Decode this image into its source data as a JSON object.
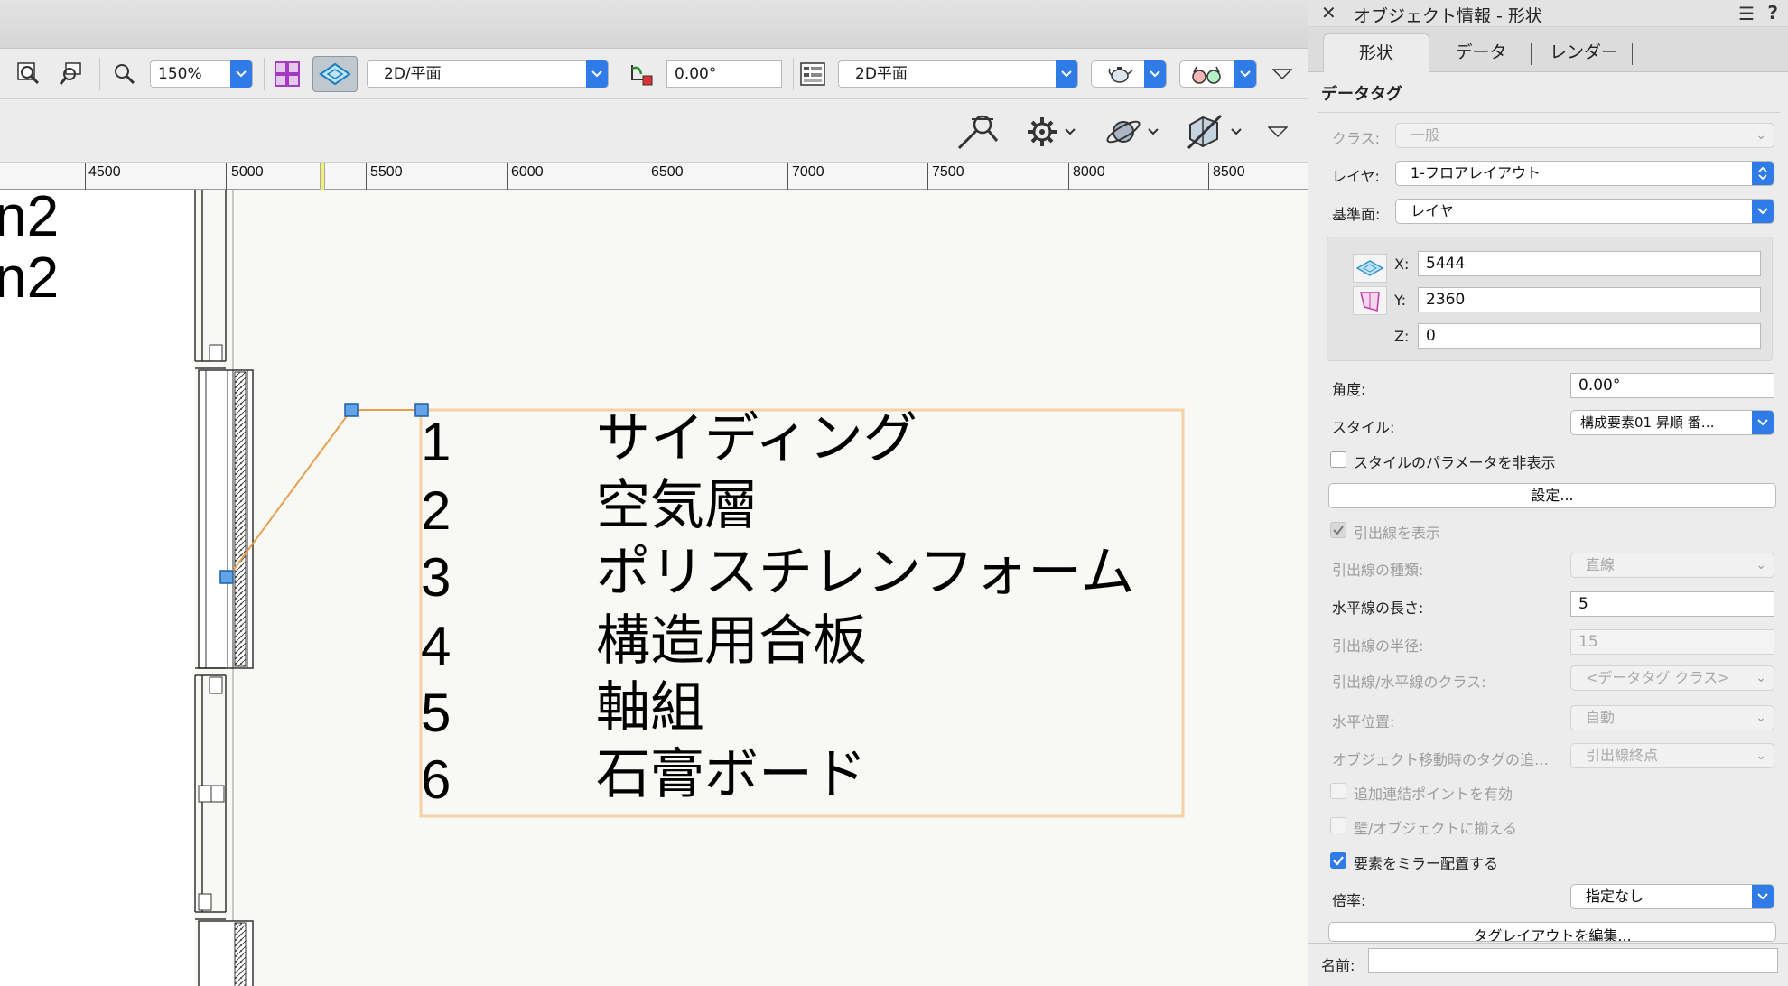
{
  "toolbar": {
    "zoom_value": "150%",
    "view_select": "2D/平面",
    "rotation_value": "0.00°",
    "plane_select": "2D平面"
  },
  "ruler": {
    "labels": [
      "4500",
      "5000",
      "5500",
      "6000",
      "6500",
      "7000",
      "7500",
      "8000",
      "8500"
    ]
  },
  "canvas": {
    "area_lines": [
      "n2",
      "n2"
    ],
    "tag_numbers": [
      "1",
      "2",
      "3",
      "4",
      "5",
      "6"
    ],
    "tag_texts": [
      "サイディング",
      "空気層",
      "ポリスチレンフォーム",
      "構造用合板",
      "軸組",
      "石膏ボード"
    ]
  },
  "panel": {
    "title": "オブジェクト情報 - 形状",
    "tabs": [
      "形状",
      "データ",
      "レンダー"
    ],
    "section": "データタグ",
    "class_label": "クラス:",
    "class_value": "一般",
    "layer_label": "レイヤ:",
    "layer_value": "1-フロアレイアウト",
    "plane_label": "基準面:",
    "plane_value": "レイヤ",
    "x_label": "X:",
    "x_value": "5444",
    "y_label": "Y:",
    "y_value": "2360",
    "z_label": "Z:",
    "z_value": "0",
    "angle_label": "角度:",
    "angle_value": "0.00°",
    "style_label": "スタイル:",
    "style_value": "構成要素01 昇順 番…",
    "hide_params_label": "スタイルのパラメータを非表示",
    "settings_button": "設定...",
    "show_leader_label": "引出線を表示",
    "leader_type_label": "引出線の種類:",
    "leader_type_value": "直線",
    "shoulder_length_label": "水平線の長さ:",
    "shoulder_length_value": "5",
    "leader_radius_label": "引出線の半径:",
    "leader_radius_value": "15",
    "leader_class_label": "引出線/水平線のクラス:",
    "leader_class_value": "<データタグ クラス>",
    "h_position_label": "水平位置:",
    "h_position_value": "自動",
    "follow_label": "オブジェクト移動時のタグの追…",
    "follow_value": "引出線終点",
    "extra_points_label": "追加連結ポイントを有効",
    "align_label": "壁/オブジェクトに揃える",
    "mirror_label": "要素をミラー配置する",
    "scale_label": "倍率:",
    "scale_value": "指定なし",
    "edit_layout_button": "タグレイアウトを編集...",
    "name_label": "名前:",
    "name_value": ""
  }
}
